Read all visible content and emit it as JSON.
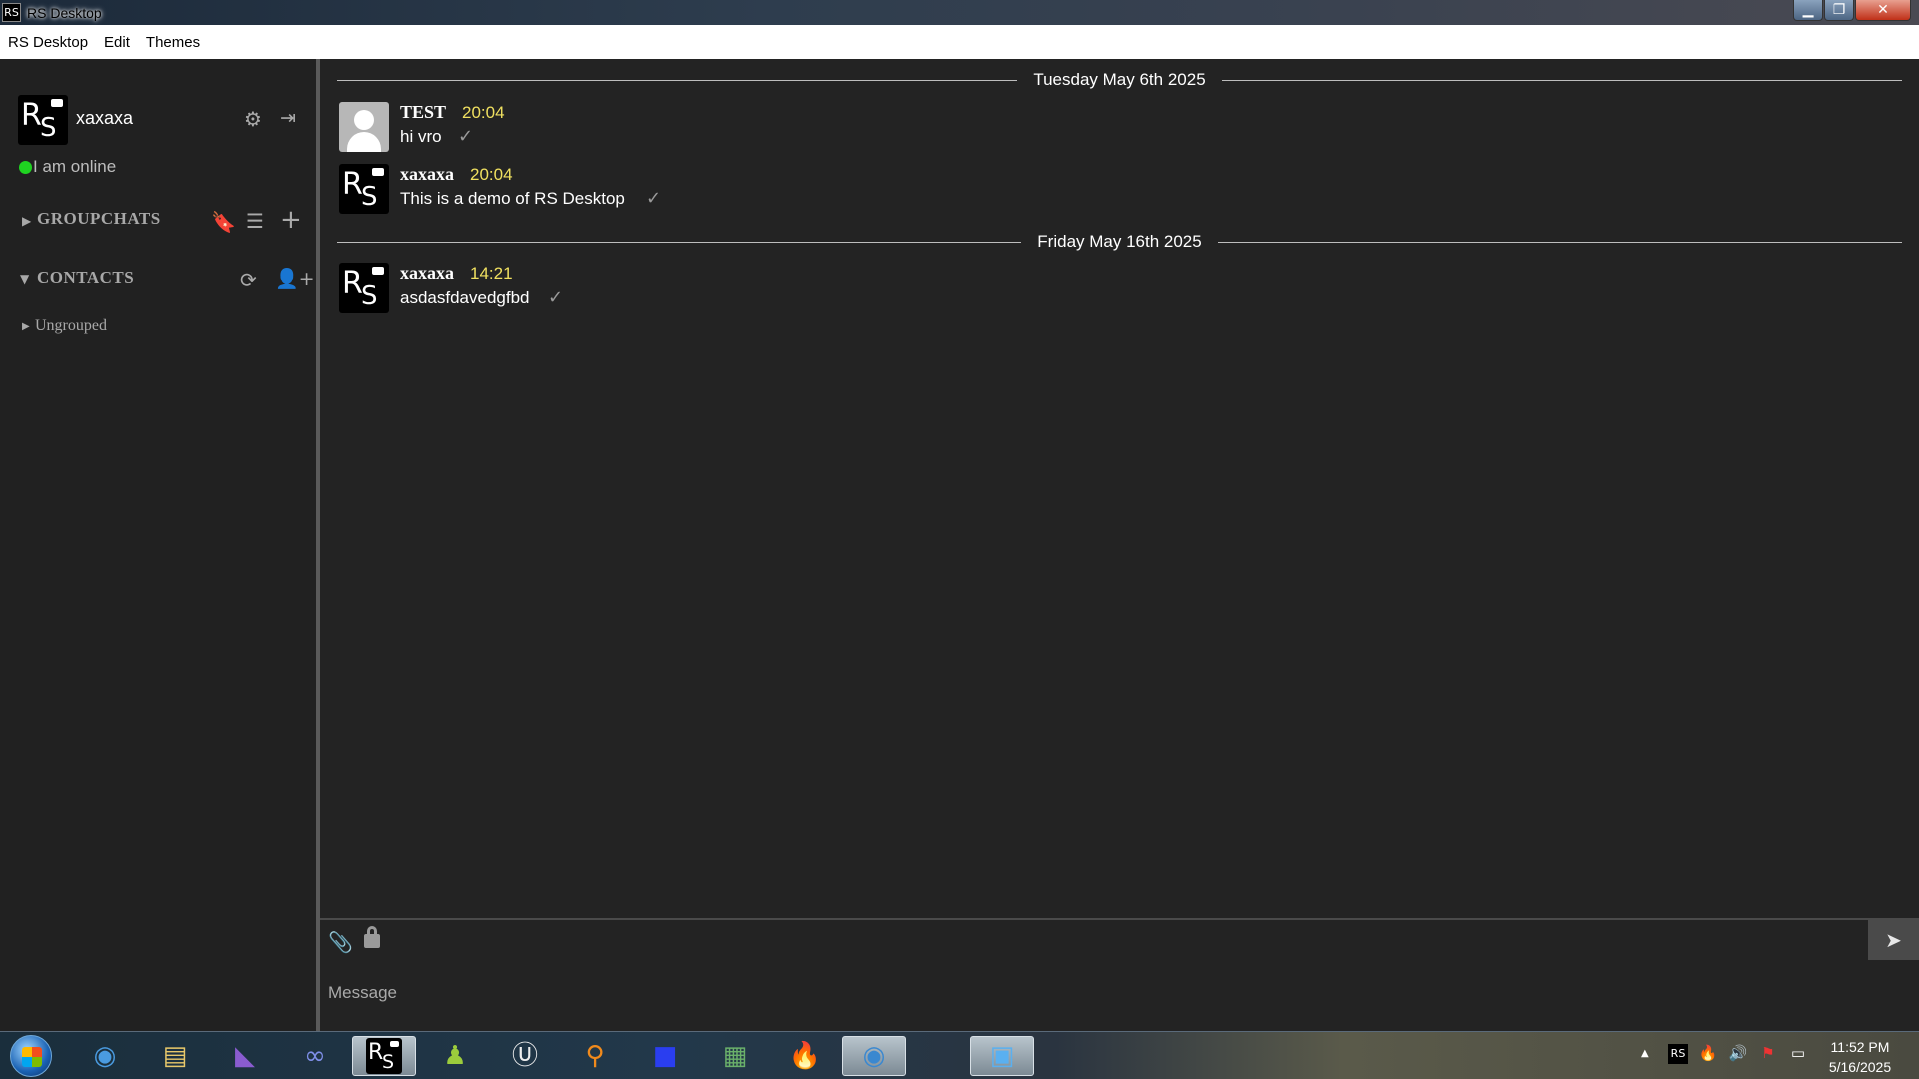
{
  "window": {
    "title": "RS Desktop",
    "app_icon_text": "RS"
  },
  "menu": {
    "items": [
      "RS Desktop",
      "Edit",
      "Themes"
    ]
  },
  "profile": {
    "name": "xaxaxa",
    "status_text": "I am online",
    "status_color": "#1fd321",
    "avatar_letters": "RS"
  },
  "sidebar": {
    "groupchats_label": "GROUPCHATS",
    "groupchats_expanded": false,
    "contacts_label": "CONTACTS",
    "contacts_expanded": true,
    "ungrouped_label": "Ungrouped"
  },
  "chat": {
    "date_separators": [
      "Tuesday May 6th 2025",
      "Friday May 16th 2025"
    ],
    "messages": [
      {
        "sender": "TEST",
        "time": "20:04",
        "text": "hi vro",
        "avatar": "default"
      },
      {
        "sender": "xaxaxa",
        "time": "20:04",
        "text": "This is a demo of RS Desktop",
        "avatar": "rs"
      },
      {
        "sender": "xaxaxa",
        "time": "14:21",
        "text": "asdasfdavedgfbd",
        "avatar": "rs"
      }
    ],
    "time_color": "#f0e060"
  },
  "composer": {
    "placeholder": "Message"
  },
  "taskbar": {
    "apps": [
      "chrome-icon",
      "file-explorer-icon",
      "visual-studio-icon",
      "infinity-app-icon",
      "rs-desktop-icon",
      "user-app-icon",
      "ble-app-icon",
      "search-app-icon",
      "app-icon-blue",
      "terminal-icon",
      "fire-app-icon",
      "chrome-icon-2",
      "remote-desktop-icon"
    ],
    "clock_time": "11:52 PM",
    "clock_date": "5/16/2025"
  }
}
